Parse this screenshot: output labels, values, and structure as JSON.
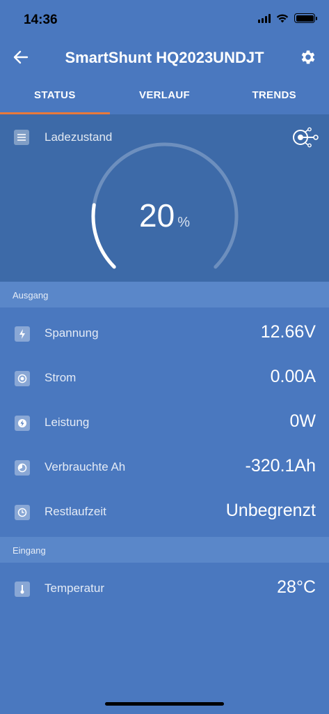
{
  "status_bar": {
    "time": "14:36"
  },
  "app_bar": {
    "title": "SmartShunt HQ2023UNDJT"
  },
  "tabs": [
    {
      "label": "STATUS",
      "active": true
    },
    {
      "label": "VERLAUF",
      "active": false
    },
    {
      "label": "TRENDS",
      "active": false
    }
  ],
  "gauge": {
    "label": "Ladezustand",
    "value": "20",
    "unit": "%",
    "fraction": 0.2
  },
  "sections": {
    "output": {
      "header": "Ausgang",
      "rows": [
        {
          "label": "Spannung",
          "value": "12.66V",
          "icon": "voltage-icon"
        },
        {
          "label": "Strom",
          "value": "0.00A",
          "icon": "current-icon"
        },
        {
          "label": "Leistung",
          "value": "0W",
          "icon": "power-icon"
        },
        {
          "label": "Verbrauchte Ah",
          "value": "-320.1Ah",
          "icon": "consumed-ah-icon"
        },
        {
          "label": "Restlaufzeit",
          "value": "Unbegrenzt",
          "icon": "clock-icon"
        }
      ]
    },
    "input": {
      "header": "Eingang",
      "rows": [
        {
          "label": "Temperatur",
          "value": "28°C",
          "icon": "thermometer-icon"
        }
      ]
    }
  },
  "colors": {
    "background": "#4a78bf",
    "gauge_panel": "#3d6aa8",
    "section_header": "#5a87c9",
    "tab_indicator": "#e8793a"
  }
}
